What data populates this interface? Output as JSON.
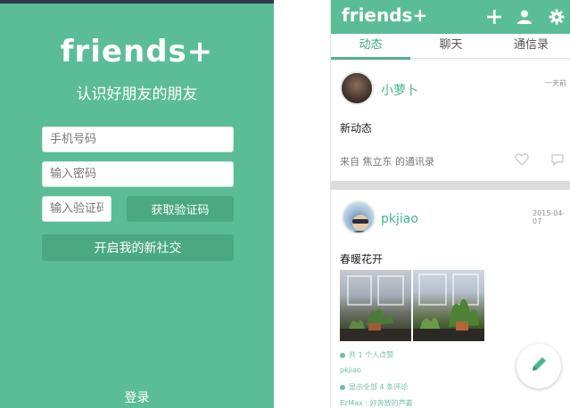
{
  "login": {
    "logo": "friends+",
    "tagline": "认识好朋友的朋友",
    "phone_placeholder": "手机号码",
    "password_placeholder": "输入密码",
    "code_placeholder": "输入验证码",
    "get_code_label": "获取验证码",
    "start_label": "开启我的新社交",
    "login_link": "登录"
  },
  "app": {
    "brand": "friends+",
    "tabs": [
      {
        "label": "动态",
        "active": true
      },
      {
        "label": "聊天",
        "active": false
      },
      {
        "label": "通信录",
        "active": false
      }
    ],
    "posts": [
      {
        "user": "小萝卜",
        "time": "一天前",
        "text": "新动态",
        "source": "来自 焦立东 的通讯录"
      },
      {
        "user": "pkjiao",
        "time": "2015-04-07",
        "text": "春暖花开",
        "likes": "共 1 个人点赞",
        "liker": "pkjiao",
        "comments": "显示全部 4 条评论",
        "comment": "EzMax : 好奔放的芦荟"
      }
    ]
  },
  "colors": {
    "accent": "#5bbd97",
    "accent_dark": "#4aa983",
    "name": "#45b58b"
  },
  "icons": {
    "add": "plus-icon",
    "profile": "person-icon",
    "settings": "gear-icon",
    "like": "heart-icon",
    "comment": "comment-icon",
    "compose": "pencil-icon"
  }
}
